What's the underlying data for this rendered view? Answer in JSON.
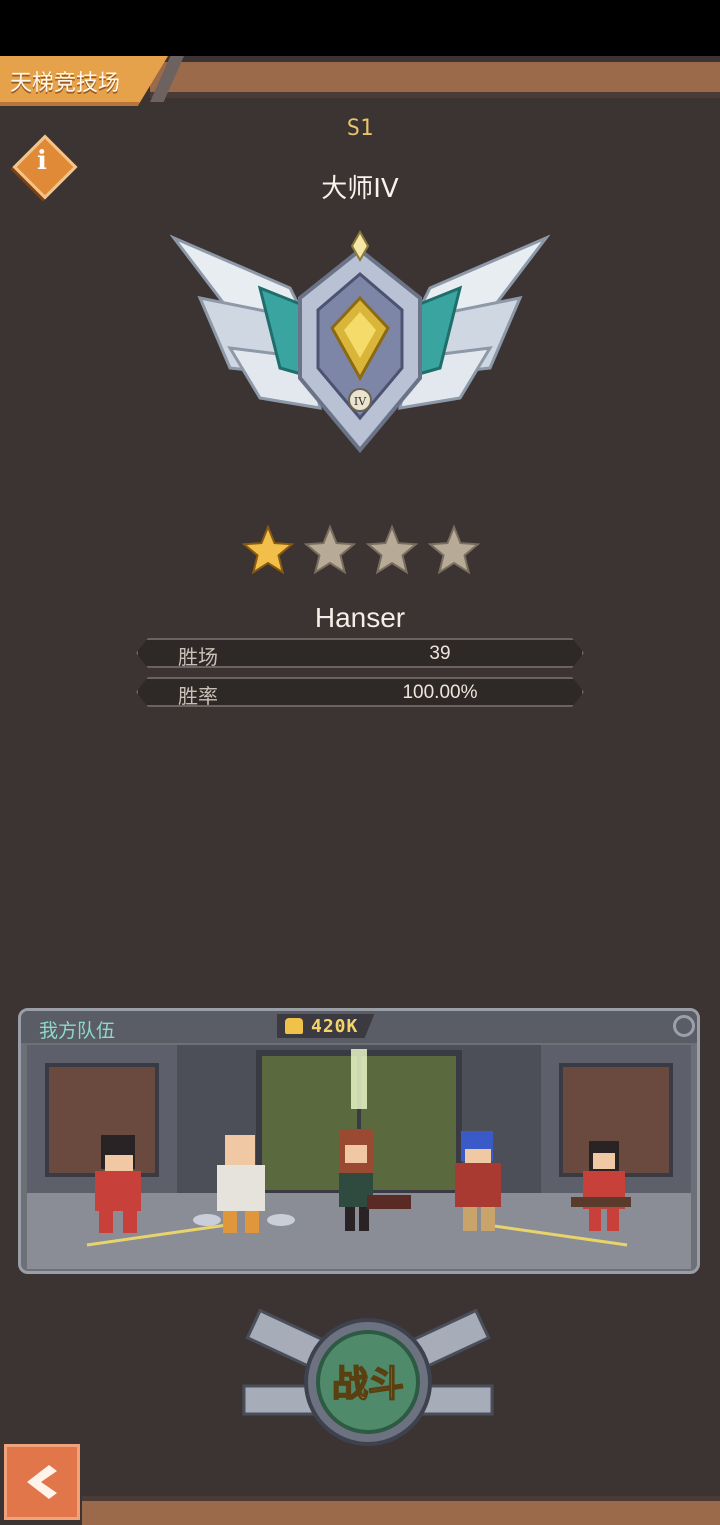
{
  "header": {
    "title": "天梯竞技场"
  },
  "season": "S1",
  "rank": {
    "name": "大师IV",
    "emblem_mark": "IV"
  },
  "stars": {
    "filled": 1,
    "total": 4
  },
  "player": {
    "name": "Hanser",
    "stats": [
      {
        "label": "胜场",
        "value": "39"
      },
      {
        "label": "胜率",
        "value": "100.00%"
      }
    ]
  },
  "team": {
    "label": "我方队伍",
    "power": "420K"
  },
  "actions": {
    "fight_label": "战斗"
  },
  "colors": {
    "accent_orange": "#e6a24a",
    "panel_bg": "#3b3432",
    "star_gold": "#f2c04a",
    "star_empty": "#b7aa96",
    "fight_green": "#4f8a6a"
  }
}
